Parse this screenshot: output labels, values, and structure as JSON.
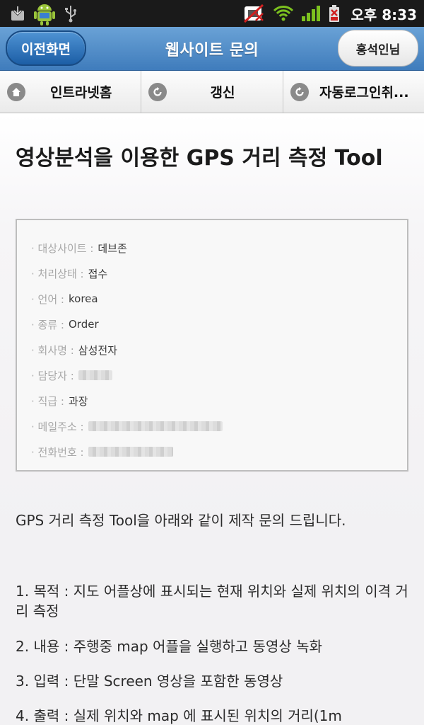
{
  "statusbar": {
    "time": "오후 8:33",
    "icons": [
      "download-icon",
      "android-icon",
      "usb-icon",
      "no-sim-icon",
      "wifi-icon",
      "signal-icon",
      "battery-icon"
    ]
  },
  "header": {
    "back_label": "이전화면",
    "title": "웹사이트 문의",
    "user_label": "홍석인님"
  },
  "nav": {
    "items": [
      {
        "label": "인트라넷홈",
        "icon": "home-icon"
      },
      {
        "label": "갱신",
        "icon": "refresh-icon"
      },
      {
        "label": "자동로그인취...",
        "icon": "refresh-icon"
      }
    ]
  },
  "post": {
    "title": "영상분석을 이용한 GPS 거리 측정 Tool",
    "info": [
      {
        "label": "대상사이트 :",
        "value": "데브존"
      },
      {
        "label": "처리상태 :",
        "value": "접수"
      },
      {
        "label": "언어 :",
        "value": "korea"
      },
      {
        "label": "종류 :",
        "value": "Order"
      },
      {
        "label": "회사명 :",
        "value": "삼성전자"
      },
      {
        "label": "담당자 :",
        "value": ""
      },
      {
        "label": "직급 :",
        "value": "과장"
      },
      {
        "label": "메일주소 :",
        "value": ""
      },
      {
        "label": "전화번호 :",
        "value": ""
      }
    ],
    "intro": "GPS 거리 측정 Tool을 아래와 같이 제작 문의 드립니다.",
    "items": [
      "1. 목적 : 지도 어플상에 표시되는 현재 위치와 실제 위치의 이격 거리 측정",
      "2. 내용 : 주행중 map 어플을 실행하고 동영상 녹화",
      "3. 입력 : 단말 Screen 영상을 포함한 동영상",
      "4. 출력 : 실제 위치와 map 에 표시된 위치의 거리(1m"
    ]
  },
  "colors": {
    "header_blue": "#3f7cbc",
    "statusbar": "#1a1a1a",
    "label_gray": "#a8a8a8"
  }
}
